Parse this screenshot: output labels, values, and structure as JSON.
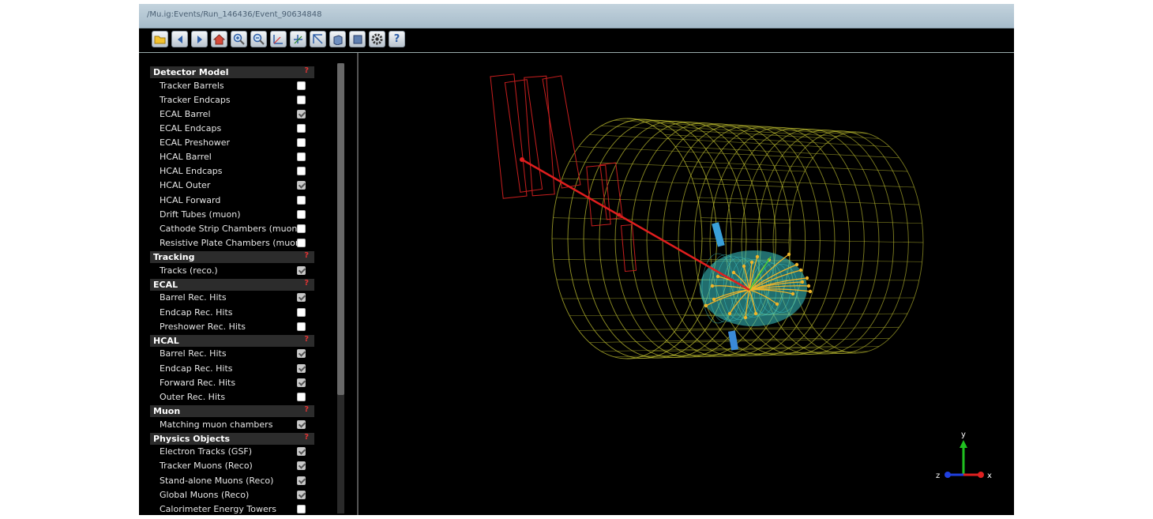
{
  "window": {
    "title": "/Mu.ig:Events/Run_146436/Event_90634848"
  },
  "toolbar": {
    "buttons": [
      {
        "name": "open-folder-icon"
      },
      {
        "name": "previous-event-icon"
      },
      {
        "name": "next-event-icon"
      },
      {
        "name": "home-view-icon"
      },
      {
        "name": "zoom-in-icon"
      },
      {
        "name": "zoom-out-icon"
      },
      {
        "name": "view-xy-icon"
      },
      {
        "name": "view-yz-icon"
      },
      {
        "name": "view-xz-icon"
      },
      {
        "name": "perspective-icon"
      },
      {
        "name": "orthographic-icon"
      },
      {
        "name": "settings-gear-icon"
      },
      {
        "name": "help-icon",
        "label": "?"
      }
    ]
  },
  "sidebar": {
    "help_marker": "?",
    "sections": [
      {
        "title": "Detector Model",
        "items": [
          {
            "label": "Tracker Barrels",
            "checked": false
          },
          {
            "label": "Tracker Endcaps",
            "checked": false
          },
          {
            "label": "ECAL Barrel",
            "checked": true
          },
          {
            "label": "ECAL Endcaps",
            "checked": false
          },
          {
            "label": "ECAL Preshower",
            "checked": false
          },
          {
            "label": "HCAL Barrel",
            "checked": false
          },
          {
            "label": "HCAL Endcaps",
            "checked": false
          },
          {
            "label": "HCAL Outer",
            "checked": true
          },
          {
            "label": "HCAL Forward",
            "checked": false
          },
          {
            "label": "Drift Tubes (muon)",
            "checked": false
          },
          {
            "label": "Cathode Strip Chambers (muon)",
            "checked": false
          },
          {
            "label": "Resistive Plate Chambers (muon)",
            "checked": false
          }
        ]
      },
      {
        "title": "Tracking",
        "items": [
          {
            "label": "Tracks (reco.)",
            "checked": true
          }
        ]
      },
      {
        "title": "ECAL",
        "items": [
          {
            "label": "Barrel Rec. Hits",
            "checked": true
          },
          {
            "label": "Endcap Rec. Hits",
            "checked": false
          },
          {
            "label": "Preshower Rec. Hits",
            "checked": false
          }
        ]
      },
      {
        "title": "HCAL",
        "items": [
          {
            "label": "Barrel Rec. Hits",
            "checked": true
          },
          {
            "label": "Endcap Rec. Hits",
            "checked": true
          },
          {
            "label": "Forward Rec. Hits",
            "checked": true
          },
          {
            "label": "Outer Rec. Hits",
            "checked": false
          }
        ]
      },
      {
        "title": "Muon",
        "items": [
          {
            "label": "Matching muon chambers",
            "checked": true
          }
        ]
      },
      {
        "title": "Physics Objects",
        "items": [
          {
            "label": "Electron Tracks (GSF)",
            "checked": true
          },
          {
            "label": "Tracker Muons (Reco)",
            "checked": true
          },
          {
            "label": "Stand-alone Muons (Reco)",
            "checked": true
          },
          {
            "label": "Global Muons (Reco)",
            "checked": true
          },
          {
            "label": "Calorimeter Energy Towers",
            "checked": false
          }
        ]
      }
    ]
  },
  "viewport": {
    "axes": {
      "x": "x",
      "y": "y",
      "z": "z"
    },
    "colors": {
      "background": "#000000",
      "hcal_outer_wireframe": "#c8c832",
      "ecal_barrel": "#3cc8c8",
      "tracks": "#f0b428",
      "muon_track": "#e01e1e",
      "muon_chambers": "#c81e1e",
      "axis_x": "#e02020",
      "axis_y": "#20c020",
      "axis_z": "#2040e0"
    }
  }
}
